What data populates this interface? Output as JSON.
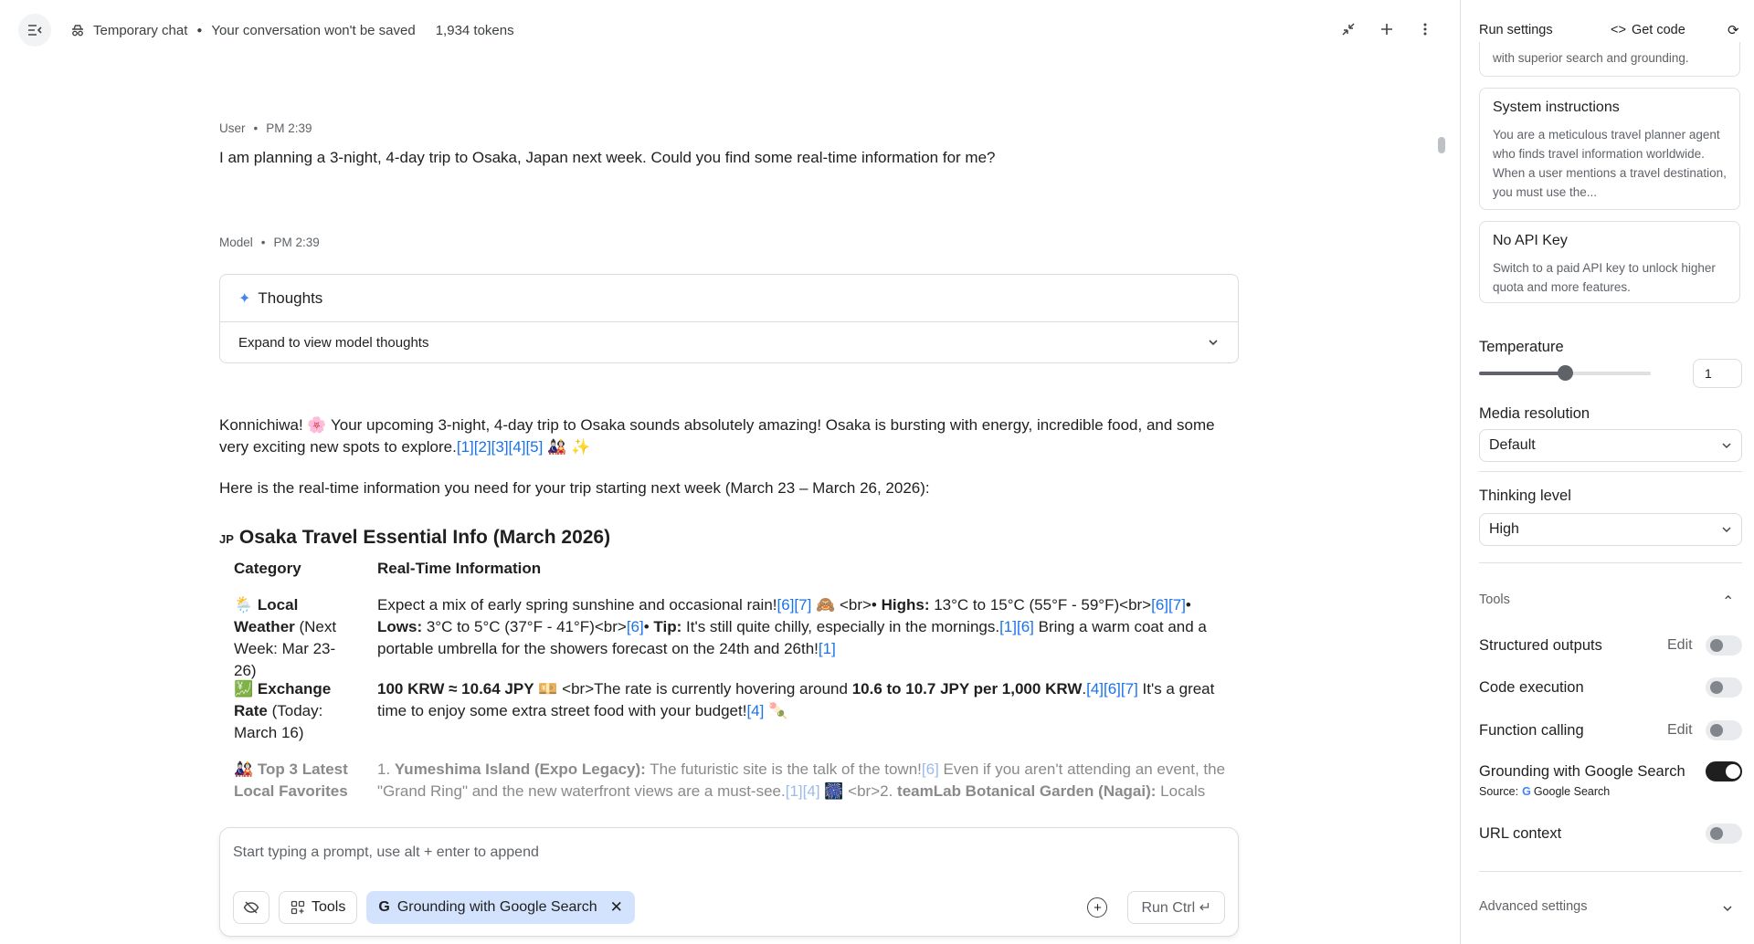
{
  "topbar": {
    "chat_mode": "Temporary chat",
    "not_saved": "Your conversation won't be saved",
    "tokens": "1,934 tokens"
  },
  "user_msg": {
    "role": "User",
    "time": "PM 2:39",
    "text": "I am planning a 3-night, 4-day trip to Osaka, Japan next week. Could you find some real-time information for me?"
  },
  "model_msg": {
    "role": "Model",
    "time": "PM 2:39",
    "thoughts_title": "Thoughts",
    "thoughts_expand": "Expand to view model thoughts",
    "intro_1": "Konnichiwa! 🌸 Your upcoming 3-night, 4-day trip to Osaka sounds absolutely amazing! Osaka is bursting with energy, incredible food, and some very exciting new spots to explore.",
    "intro_1_cites": "[1][2][3][4][5]",
    "intro_1_end": " 🎎 ✨",
    "intro_2": "Here is the real-time information you need for your trip starting next week (March 23 – March 26, 2026):",
    "heading_flag": "JP",
    "heading": "Osaka Travel Essential Info (March 2026)",
    "table_headers": [
      "Category",
      "Real-Time Information"
    ],
    "row_weather": {
      "emoji": "🌦️",
      "cat_bold": "Local Weather",
      "cat_rest": " (Next Week: Mar 23-26)",
      "p1": "Expect a mix of early spring sunshine and occasional rain!",
      "c1": "[6][7]",
      "p2": " 🙈 <br>• ",
      "b1": "Highs:",
      "p3": " 13°C to 15°C (55°F - 59°F)<br>",
      "c2": "[6][7]",
      "p4": "• ",
      "b2": "Lows:",
      "p5": " 3°C to 5°C (37°F - 41°F)<br>",
      "c3": "[6]",
      "p6": "• ",
      "b3": "Tip:",
      "p7": " It's still quite chilly, especially in the mornings.",
      "c4": "[1][6]",
      "p8": " Bring a warm coat and a portable umbrella for the showers forecast on the 24th and 26th!",
      "c5": "[1]"
    },
    "row_exchange": {
      "emoji": "💹",
      "cat_bold": "Exchange Rate",
      "cat_rest": " (Today: March 16)",
      "b1": "100 KRW ≈ 10.64 JPY",
      "p1": " 💴 <br>The rate is currently hovering around ",
      "b2": "10.6 to 10.7 JPY per 1,000 KRW",
      "p2": ".",
      "c1": "[4][6][7]",
      "p3": " It's a great time to enjoy some extra street food with your budget!",
      "c2": "[4]",
      "p4": " 🍡"
    },
    "row_favorites": {
      "emoji": "🎎",
      "cat_bold": "Top 3 Latest Local Favorites",
      "p1": "1. ",
      "b1": "Yumeshima Island (Expo Legacy):",
      "p2": " The futuristic site is the talk of the town!",
      "c1": "[6]",
      "p3": " Even if you aren't attending an event, the \"Grand Ring\" and the new waterfront views are a must-see.",
      "c2": "[1][4]",
      "p4": " 🎆 <br>2. ",
      "b2": "teamLab Botanical Garden (Nagai):",
      "p5": " Locals"
    }
  },
  "composer": {
    "placeholder": "Start typing a prompt, use alt + enter to append",
    "tools_label": "Tools",
    "grounding_chip": "Grounding with Google Search",
    "run_label": "Run Ctrl ↵"
  },
  "panel": {
    "title": "Run settings",
    "get_code": "Get code",
    "model_desc_tail": "with superior search and grounding.",
    "system_title": "System instructions",
    "system_text": "You are a meticulous travel planner agent who finds travel information worldwide. When a user mentions a travel destination, you must use the...",
    "apikey_title": "No API Key",
    "apikey_text": "Switch to a paid API key to unlock higher quota and more features.",
    "temperature_label": "Temperature",
    "temperature_value": "1",
    "temperature_fraction": 0.5,
    "media_label": "Media resolution",
    "media_value": "Default",
    "thinking_label": "Thinking level",
    "thinking_value": "High",
    "tools_label": "Tools",
    "structured_outputs": "Structured outputs",
    "edit": "Edit",
    "code_execution": "Code execution",
    "function_calling": "Function calling",
    "grounding": "Grounding with Google Search",
    "source_label": "Source:",
    "source_value": "Google Search",
    "url_context": "URL context",
    "advanced": "Advanced settings"
  }
}
